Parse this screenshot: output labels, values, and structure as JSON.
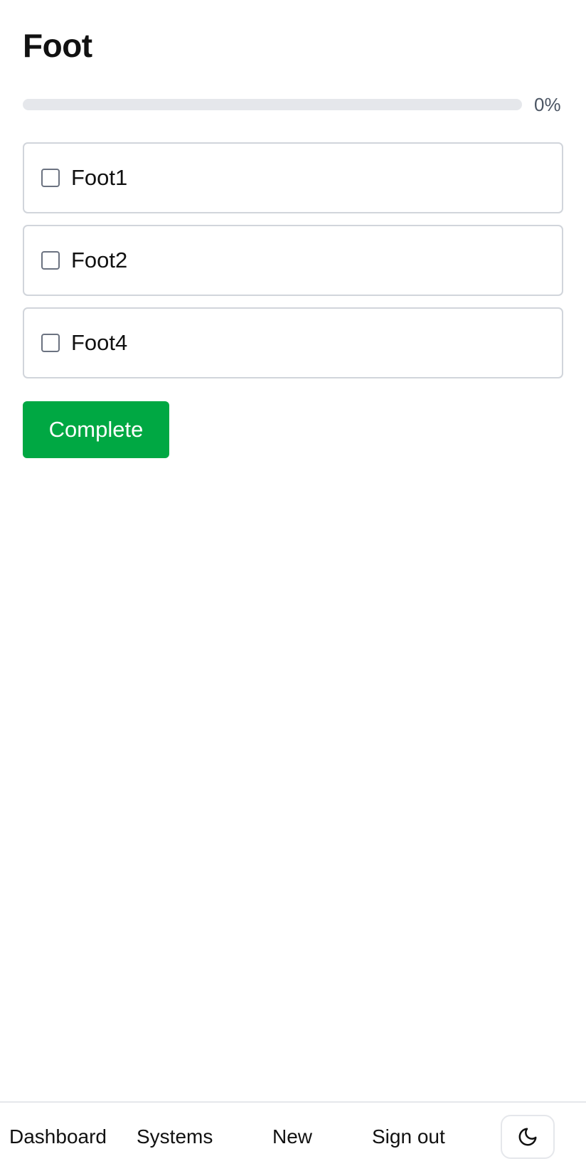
{
  "page": {
    "title": "Foot"
  },
  "progress": {
    "value": 0,
    "label": "0%"
  },
  "tasks": [
    {
      "label": "Foot1",
      "checked": false
    },
    {
      "label": "Foot2",
      "checked": false
    },
    {
      "label": "Foot4",
      "checked": false
    }
  ],
  "actions": {
    "complete_label": "Complete"
  },
  "nav": {
    "dashboard": "Dashboard",
    "systems": "Systems",
    "new": "New",
    "sign_out": "Sign out",
    "theme_icon": "moon-icon"
  },
  "colors": {
    "accent": "#00a843",
    "progress_track": "#e5e7eb",
    "border": "#d1d5db",
    "muted_text": "#4b5563"
  }
}
